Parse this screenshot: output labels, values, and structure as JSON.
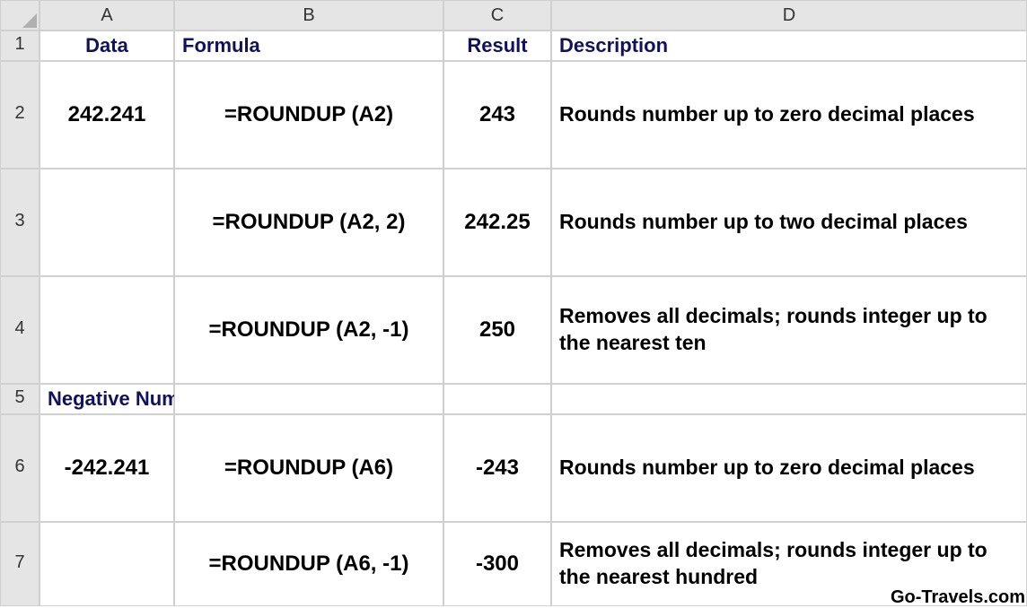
{
  "columns": {
    "corner": "",
    "A": "A",
    "B": "B",
    "C": "C",
    "D": "D"
  },
  "rowlabels": {
    "r1": "1",
    "r2": "2",
    "r3": "3",
    "r4": "4",
    "r5": "5",
    "r6": "6",
    "r7": "7"
  },
  "header": {
    "A": "Data",
    "B": "Formula",
    "C": "Result",
    "D": "Description"
  },
  "rows": {
    "r2": {
      "A": "242.241",
      "B": "=ROUNDUP (A2)",
      "C": "243",
      "D": "Rounds number up to zero decimal places"
    },
    "r3": {
      "A": "",
      "B": "=ROUNDUP (A2, 2)",
      "C": "242.25",
      "D": "Rounds number up to two decimal places"
    },
    "r4": {
      "A": "",
      "B": "=ROUNDUP (A2, -1)",
      "C": "250",
      "D": "Removes all decimals; rounds integer up to the nearest ten"
    },
    "r5": {
      "A": "Negative Numbers",
      "B": "",
      "C": "",
      "D": ""
    },
    "r6": {
      "A": "-242.241",
      "B": "=ROUNDUP (A6)",
      "C": "-243",
      "D": "Rounds number up to zero decimal places"
    },
    "r7": {
      "A": "",
      "B": "=ROUNDUP (A6, -1)",
      "C": "-300",
      "D": "Removes all decimals; rounds integer up to the nearest hundred"
    }
  },
  "watermark": "Go-Travels.com"
}
